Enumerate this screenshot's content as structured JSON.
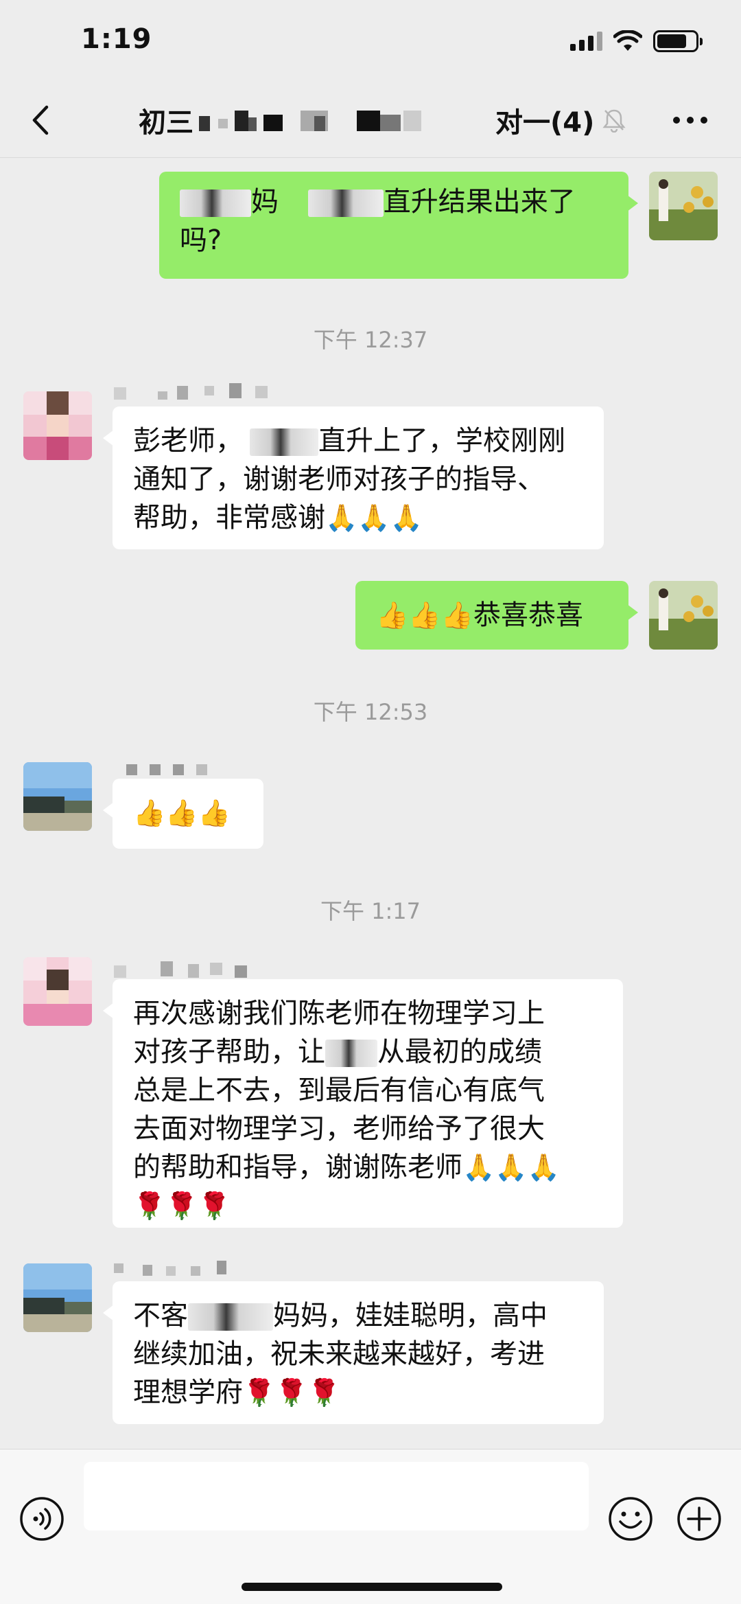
{
  "status_bar": {
    "time": "1:19"
  },
  "header": {
    "title_prefix": "初三",
    "title_suffix": "对一(4)",
    "back_icon": "chevron-left-icon",
    "mute_icon": "bell-muted-icon",
    "more_icon": "ellipsis-icon"
  },
  "messages": [
    {
      "type": "outgoing",
      "text_a": "妈",
      "text_b": "直升结果出来了",
      "text_c": "吗?"
    },
    {
      "type": "time",
      "text": "下午 12:37"
    },
    {
      "type": "incoming",
      "line1_a": "彭老师，",
      "line1_b": "直升上了，学校刚刚",
      "line2": "通知了，谢谢老师对孩子的指导、",
      "line3": "帮助，非常感谢",
      "emoji": "🙏🙏🙏"
    },
    {
      "type": "outgoing",
      "emoji": "👍👍👍",
      "text": "恭喜恭喜"
    },
    {
      "type": "time",
      "text": "下午 12:53"
    },
    {
      "type": "incoming",
      "emoji": "👍👍👍"
    },
    {
      "type": "time",
      "text": "下午 1:17"
    },
    {
      "type": "incoming",
      "line1": "再次感谢我们陈老师在物理学习上",
      "line2_a": "对孩子帮助，让",
      "line2_b": "从最初的成绩",
      "line3": "总是上不去，到最后有信心有底气",
      "line4": "去面对物理学习，老师给予了很大",
      "line5": "的帮助和指导，谢谢陈老师",
      "emoji_a": "🙏🙏🙏",
      "emoji_b": "🌹🌹🌹"
    },
    {
      "type": "incoming",
      "line1_a": "不客",
      "line1_b": "妈妈，娃娃聪明，高中",
      "line2": "继续加油，祝未来越来越好，考进",
      "line3": "理想学府",
      "emoji": "🌹🌹🌹"
    }
  ],
  "input_bar": {
    "voice_icon": "voice-icon",
    "emoji_icon": "smiley-icon",
    "plus_icon": "plus-circle-icon",
    "placeholder": ""
  },
  "colors": {
    "outgoing": "#95ec69",
    "incoming": "#ffffff",
    "background": "#ededed"
  }
}
